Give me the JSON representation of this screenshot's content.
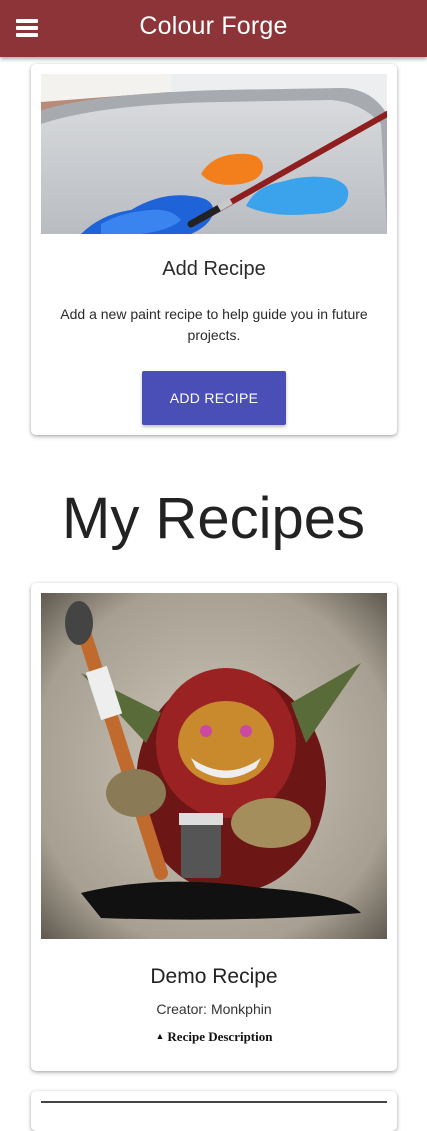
{
  "header": {
    "title": "Colour Forge",
    "menu_icon": "hamburger-menu-icon",
    "background_color": "#8d3439"
  },
  "add_card": {
    "image_icon": "paint-palette-image",
    "title": "Add Recipe",
    "description": "Add a new paint recipe to help guide you in future projects.",
    "button_label": "ADD RECIPE",
    "button_color": "#4a4fb8"
  },
  "section": {
    "title": "My Recipes"
  },
  "recipes": [
    {
      "image_icon": "goblin-painter-image",
      "title": "Demo Recipe",
      "creator_label": "Creator:",
      "creator_name": "Monkphin",
      "description_toggle_icon": "caret-up-icon",
      "description_toggle_label": "Recipe Description"
    }
  ]
}
